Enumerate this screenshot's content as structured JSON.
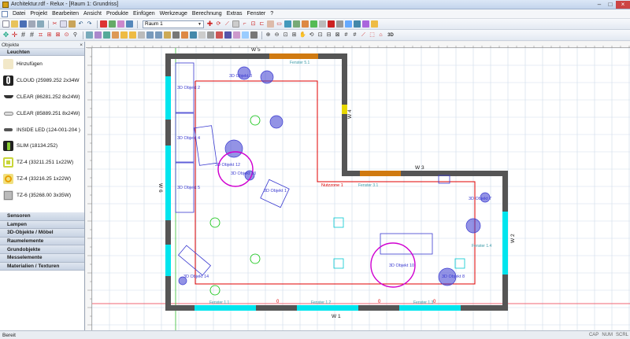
{
  "titlebar": {
    "title": "Architektur.rdf - Relux - [Raum 1: Grundriss]"
  },
  "menubar": {
    "items": [
      "Datei",
      "Projekt",
      "Bearbeiten",
      "Ansicht",
      "Produkte",
      "Einfügen",
      "Werkzeuge",
      "Berechnung",
      "Extras",
      "Fenster",
      "?"
    ]
  },
  "toolbar": {
    "room_select": "Raum 1"
  },
  "panel": {
    "title": "Objekte",
    "active_category": "Leuchten",
    "luminaires": [
      {
        "label": "Hinzufügen"
      },
      {
        "label": "CLOUD (25989.252 2x34W"
      },
      {
        "label": "CLEAR (86281.252 8x24W)"
      },
      {
        "label": "CLEAR (85889.251 8x24W)"
      },
      {
        "label": "INSIDE LED (124-001-204 )"
      },
      {
        "label": "SLIM (18134.252)"
      },
      {
        "label": "TZ-4 (33211.251 1x22W)"
      },
      {
        "label": "TZ-4 (33216.25 1x22W)"
      },
      {
        "label": "TZ-6 (35268.00 3x35W)"
      }
    ],
    "categories": [
      "Sensoren",
      "Lampen",
      "3D-Objekte / Möbel",
      "Raumelemente",
      "Grundobjekte",
      "Messelemente",
      "Materialien / Texturen"
    ]
  },
  "canvas": {
    "wall_labels": {
      "w1": "W 1",
      "w2": "W 2",
      "w3": "W 3",
      "w4": "W 4",
      "w5": "W 5",
      "w6": "W 6"
    },
    "zone_label": "Nutzzone 1",
    "window_labels": [
      "Fenster 1.1",
      "Fenster 1.2",
      "Fenster 1.3",
      "Fenster 1.4",
      "Fenster 3.1",
      "Fenster 5.1"
    ],
    "object_labels": [
      "3D Objekt 3",
      "3D Objekt 12",
      "3D Objekt 13",
      "3D Objekt 7",
      "3D Objekt 10",
      "3D Objekt 8",
      "3D Objekt 14",
      "3D Objekt 1",
      "3D Objekt 5",
      "3D Objekt 4",
      "3D Objekt 2"
    ],
    "door_marks": [
      "0",
      "0",
      "0"
    ]
  },
  "statusbar": {
    "text": "Bereit",
    "indicators": [
      "CAP",
      "NUM",
      "SCRL"
    ]
  },
  "colors": {
    "wall": "#555555",
    "window": "#00e5ee",
    "zone": "#e00000",
    "furniture": "#3a3ad0",
    "luminaire_circle": "#00c000",
    "selected": "#d000d0",
    "grid": "#cfdcea"
  }
}
